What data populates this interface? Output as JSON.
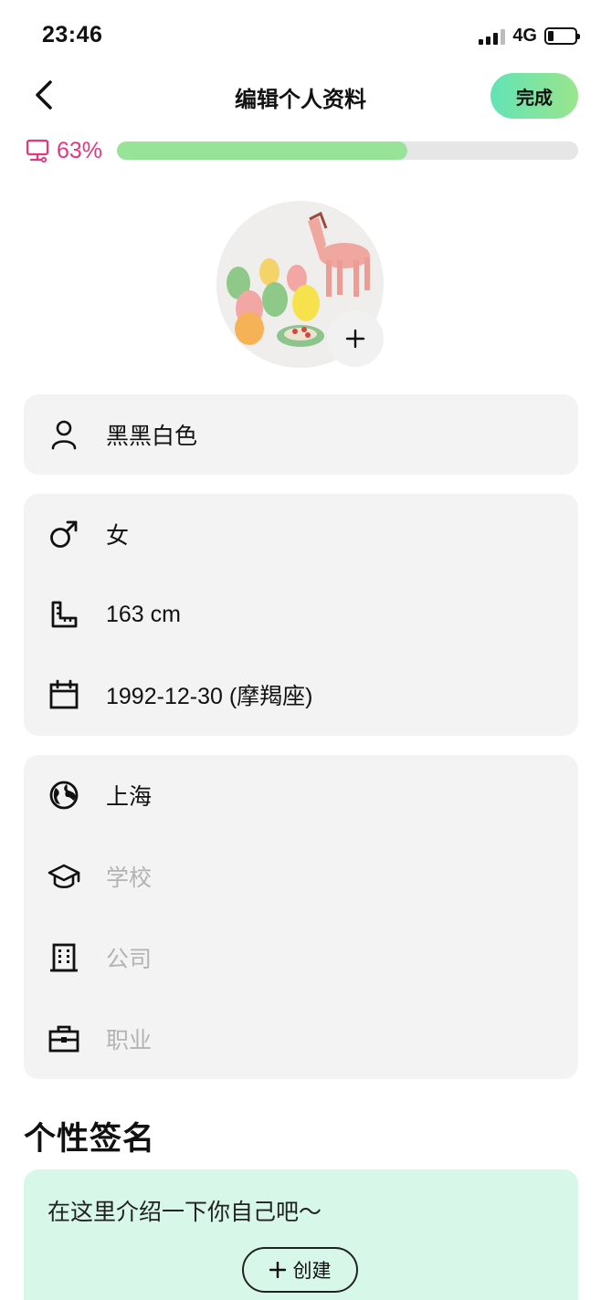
{
  "status_bar": {
    "time": "23:46",
    "network": "4G"
  },
  "header": {
    "title": "编辑个人资料",
    "done_label": "完成"
  },
  "progress": {
    "percent_label": "63%",
    "value": 0.63,
    "color": "#e8367e"
  },
  "avatar": {
    "add_icon": "plus-icon"
  },
  "profile": {
    "name": "黑黑白色"
  },
  "basics": {
    "gender": "女",
    "height": "163 cm",
    "birthday": "1992-12-30 (摩羯座)"
  },
  "details": {
    "city": "上海",
    "school_placeholder": "学校",
    "company_placeholder": "公司",
    "job_placeholder": "职业"
  },
  "signature": {
    "title": "个性签名",
    "placeholder": "在这里介绍一下你自己吧～",
    "create_label": "创建"
  },
  "colors": {
    "accent": "#62e3b6",
    "progress_fill": "#97e499",
    "bio_bg": "#d7f7e9"
  }
}
